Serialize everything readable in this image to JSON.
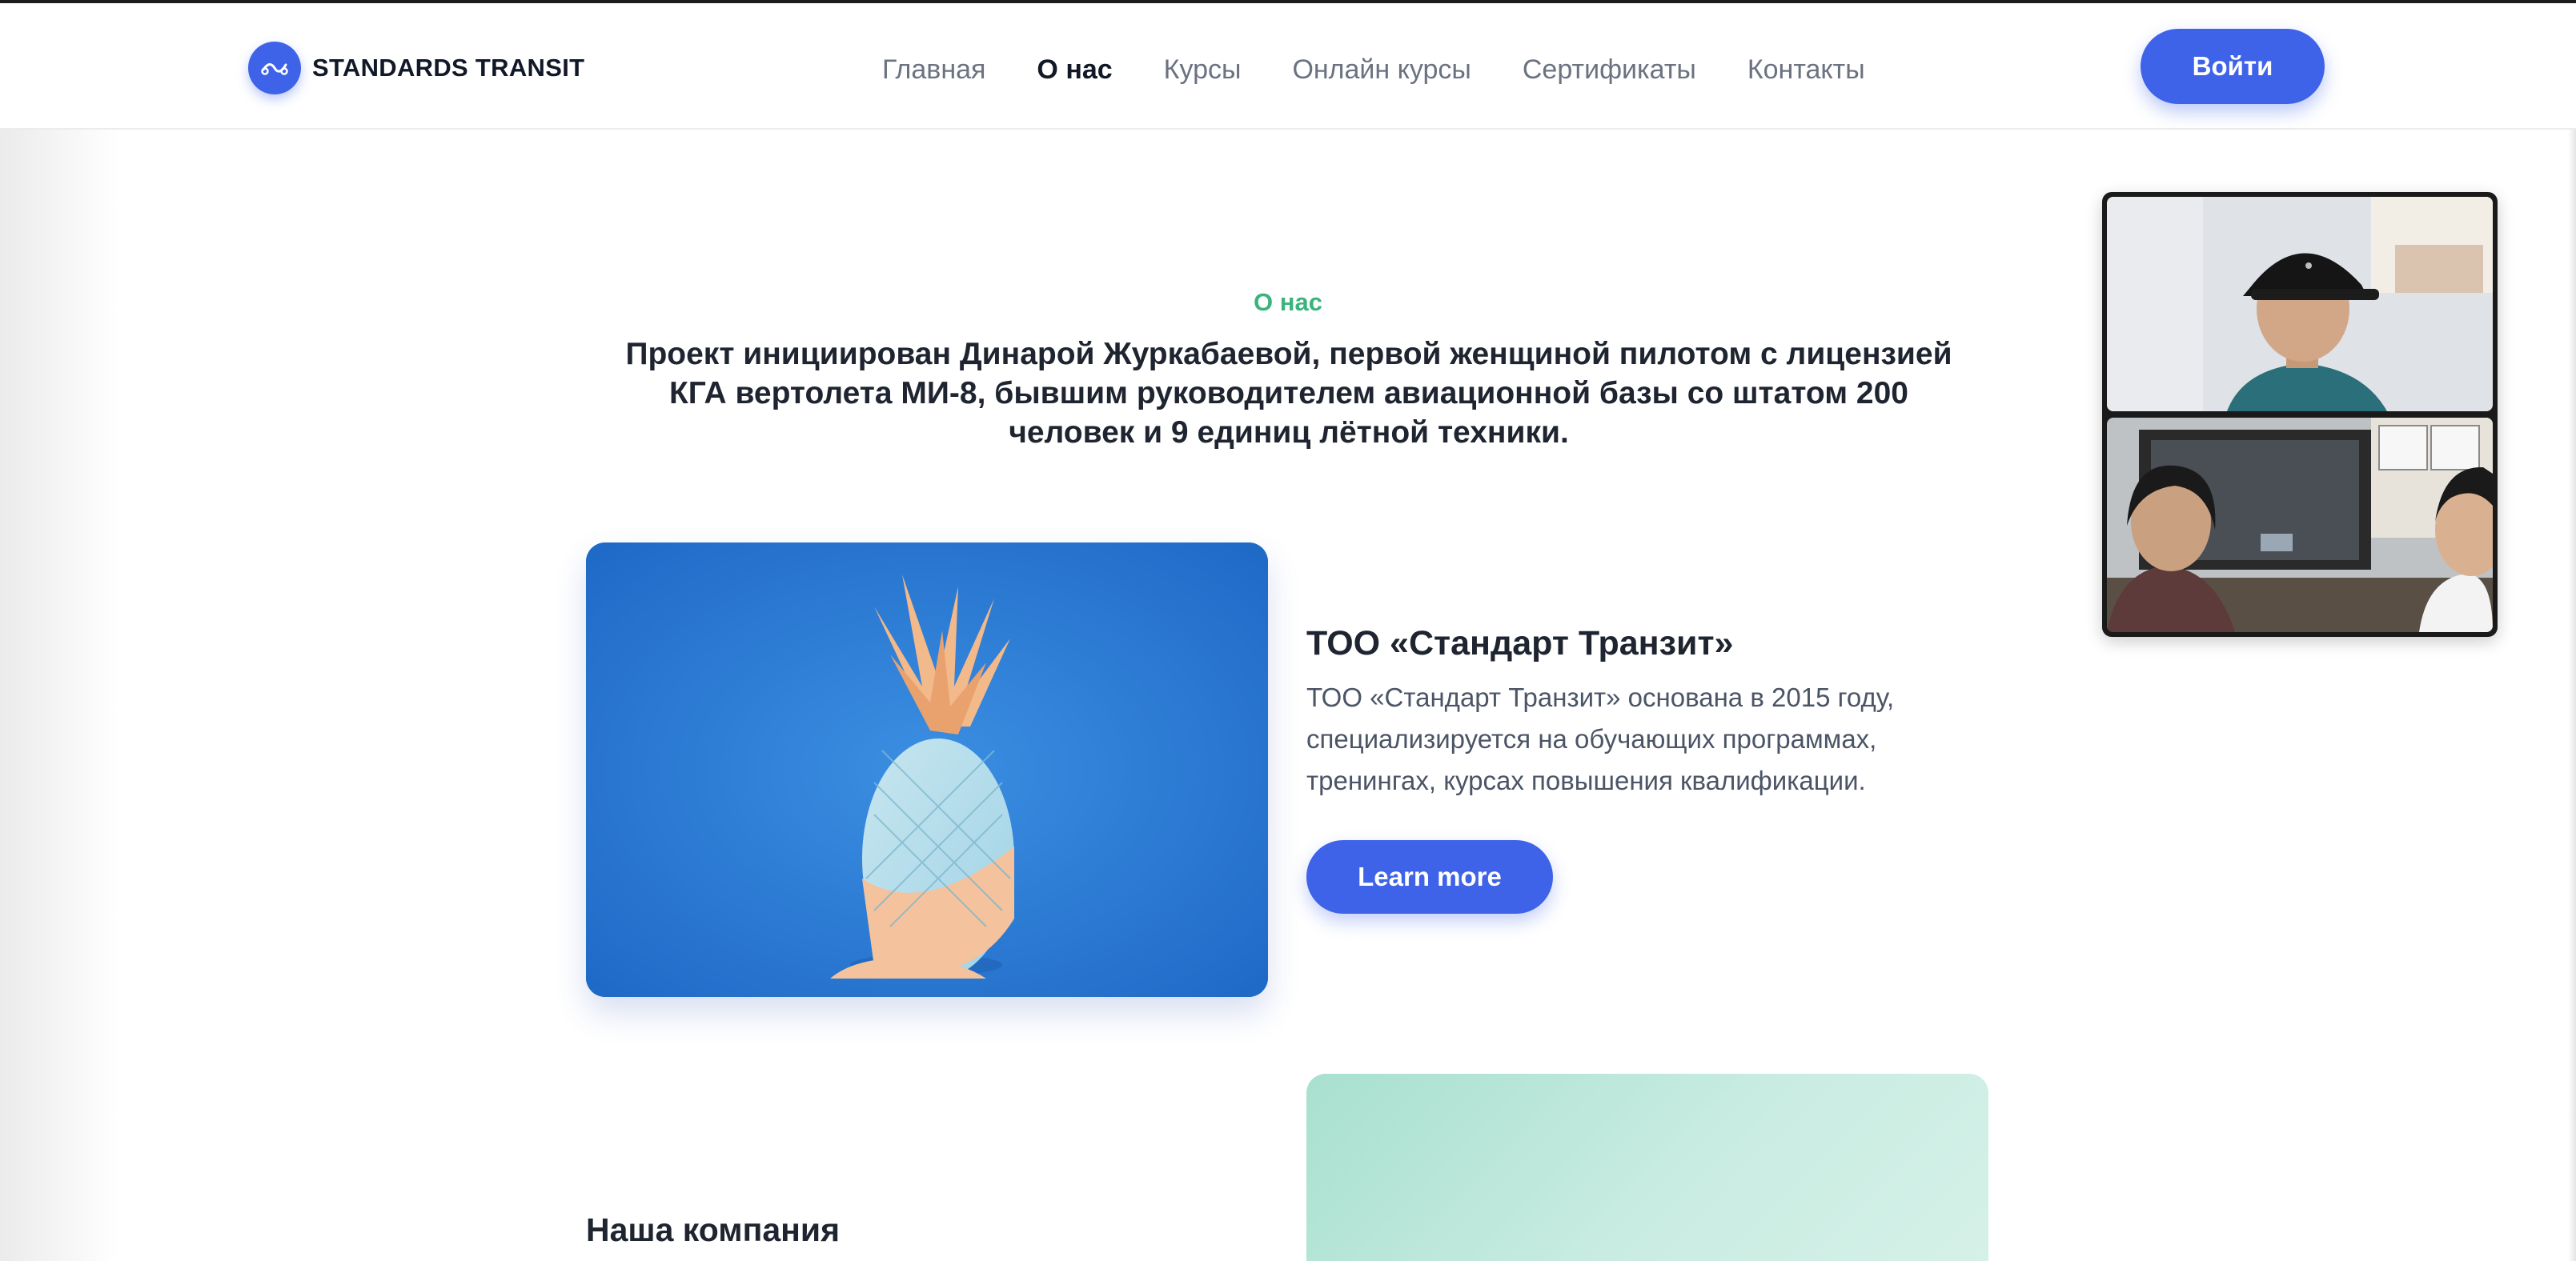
{
  "header": {
    "brand": "STANDARDS TRANSIT",
    "nav": [
      {
        "label": "Главная"
      },
      {
        "label": "О нас"
      },
      {
        "label": "Курсы"
      },
      {
        "label": "Онлайн курсы"
      },
      {
        "label": "Сертификаты"
      },
      {
        "label": "Контакты"
      }
    ],
    "active_nav": "О нас",
    "login_label": "Войти"
  },
  "about": {
    "eyebrow": "О нас",
    "intro": "Проект инициирован Динарой Журкабаевой, первой женщиной пилотом с лицензией КГА вертолета МИ-8, бывшим руководителем авиационной базы со штатом  200 человек и 9 единиц лётной техники."
  },
  "company": {
    "title": "ТОО «Стандарт Транзит»",
    "description": "ТОО «Стандарт Транзит» основана в 2015 году, специализируется на обучающих программах, тренингах, курсах повышения квалификации.",
    "button_label": "Learn more"
  },
  "our_company": {
    "title": "Наша компания"
  },
  "colors": {
    "accent": "#3f63e8",
    "eyebrow_green": "#3bb37c",
    "pineapple_bg": "#2f80d8",
    "mint_card": "#c9ece2"
  }
}
